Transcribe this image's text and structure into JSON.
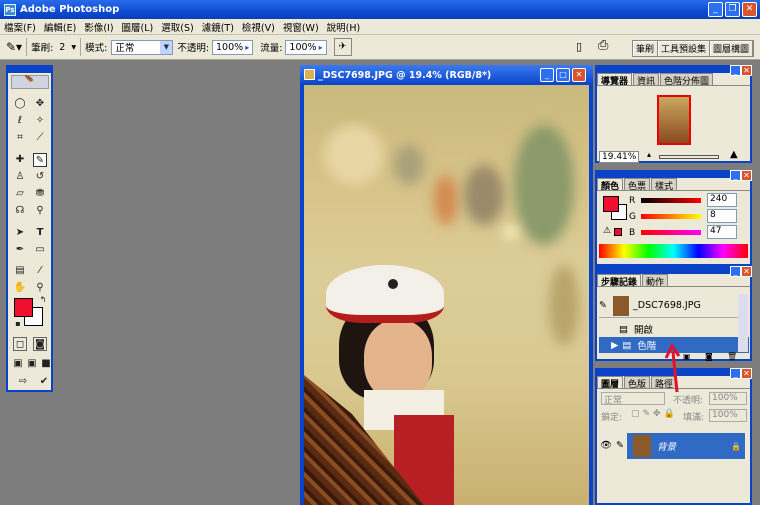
{
  "app": {
    "title": "Adobe Photoshop"
  },
  "menu": [
    "檔案(F)",
    "編輯(E)",
    "影像(I)",
    "圖層(L)",
    "選取(S)",
    "濾鏡(T)",
    "檢視(V)",
    "視窗(W)",
    "說明(H)"
  ],
  "options": {
    "brush_label": "筆刷:",
    "brush_size": "2",
    "mode_label": "模式:",
    "mode_value": "正常",
    "opacity_label": "不透明:",
    "opacity_value": "100%",
    "flow_label": "流量:",
    "flow_value": "100%",
    "palette_tabs": [
      "筆刷",
      "工具預設集",
      "圖層構圖"
    ]
  },
  "document": {
    "title": "_DSC7698.JPG @ 19.4% (RGB/8*)"
  },
  "navigator": {
    "tabs": [
      "導覽器",
      "資訊",
      "色階分佈圖"
    ],
    "zoom": "19.41%"
  },
  "color": {
    "tabs": [
      "顏色",
      "色票",
      "樣式"
    ],
    "r_label": "R",
    "g_label": "G",
    "b_label": "B",
    "r": "240",
    "g": "8",
    "b": "47",
    "fg": "#f00f2f"
  },
  "history": {
    "tabs": [
      "步驟記錄",
      "動作"
    ],
    "snapshot": "_DSC7698.JPG",
    "items": [
      "開啟",
      "色階"
    ]
  },
  "layers": {
    "tabs": [
      "圖層",
      "色版",
      "路徑"
    ],
    "mode": "正常",
    "opacity_label": "不透明:",
    "opacity": "100%",
    "lock_label": "鎖定:",
    "fill_label": "填滿:",
    "fill": "100%",
    "layer_name": "背景"
  }
}
